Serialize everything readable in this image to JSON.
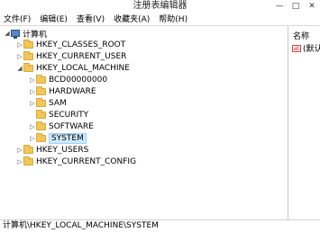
{
  "window": {
    "title": "注册表编辑器"
  },
  "window_controls": {
    "minimize": "—",
    "maximize": "□",
    "close": "✕"
  },
  "menu": [
    "文件(F)",
    "编辑(E)",
    "查看(V)",
    "收藏夹(A)",
    "帮助(H)"
  ],
  "tree": {
    "root": "计算机",
    "hkcr": "HKEY_CLASSES_ROOT",
    "hkcu": "HKEY_CURRENT_USER",
    "hklm": "HKEY_LOCAL_MACHINE",
    "hklm_children": [
      "BCD00000000",
      "HARDWARE",
      "SAM",
      "SECURITY",
      "SOFTWARE",
      "SYSTEM"
    ],
    "hku": "HKEY_USERS",
    "hkcc": "HKEY_CURRENT_CONFIG",
    "selected": "SYSTEM"
  },
  "right_pane": {
    "column_name": "名称",
    "value_label": "(默认"
  },
  "status": "计算机\\HKEY_LOCAL_MACHINE\\SYSTEM"
}
